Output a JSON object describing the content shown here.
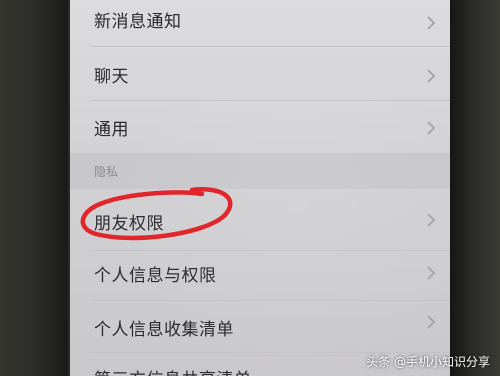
{
  "settings": {
    "items_top": [
      {
        "label": "新消息通知"
      },
      {
        "label": "聊天"
      },
      {
        "label": "通用"
      }
    ],
    "privacy_section": {
      "header": "隐私",
      "items": [
        {
          "label": "朋友权限"
        },
        {
          "label": "个人信息与权限"
        },
        {
          "label": "个人信息收集清单"
        },
        {
          "label": "第三方信息共享清单"
        }
      ]
    }
  },
  "annotation": {
    "color": "#e0262b"
  },
  "watermark": {
    "text": "头条 @手机小知识分享"
  },
  "icons": {
    "chevron": "chevron-right-icon"
  }
}
